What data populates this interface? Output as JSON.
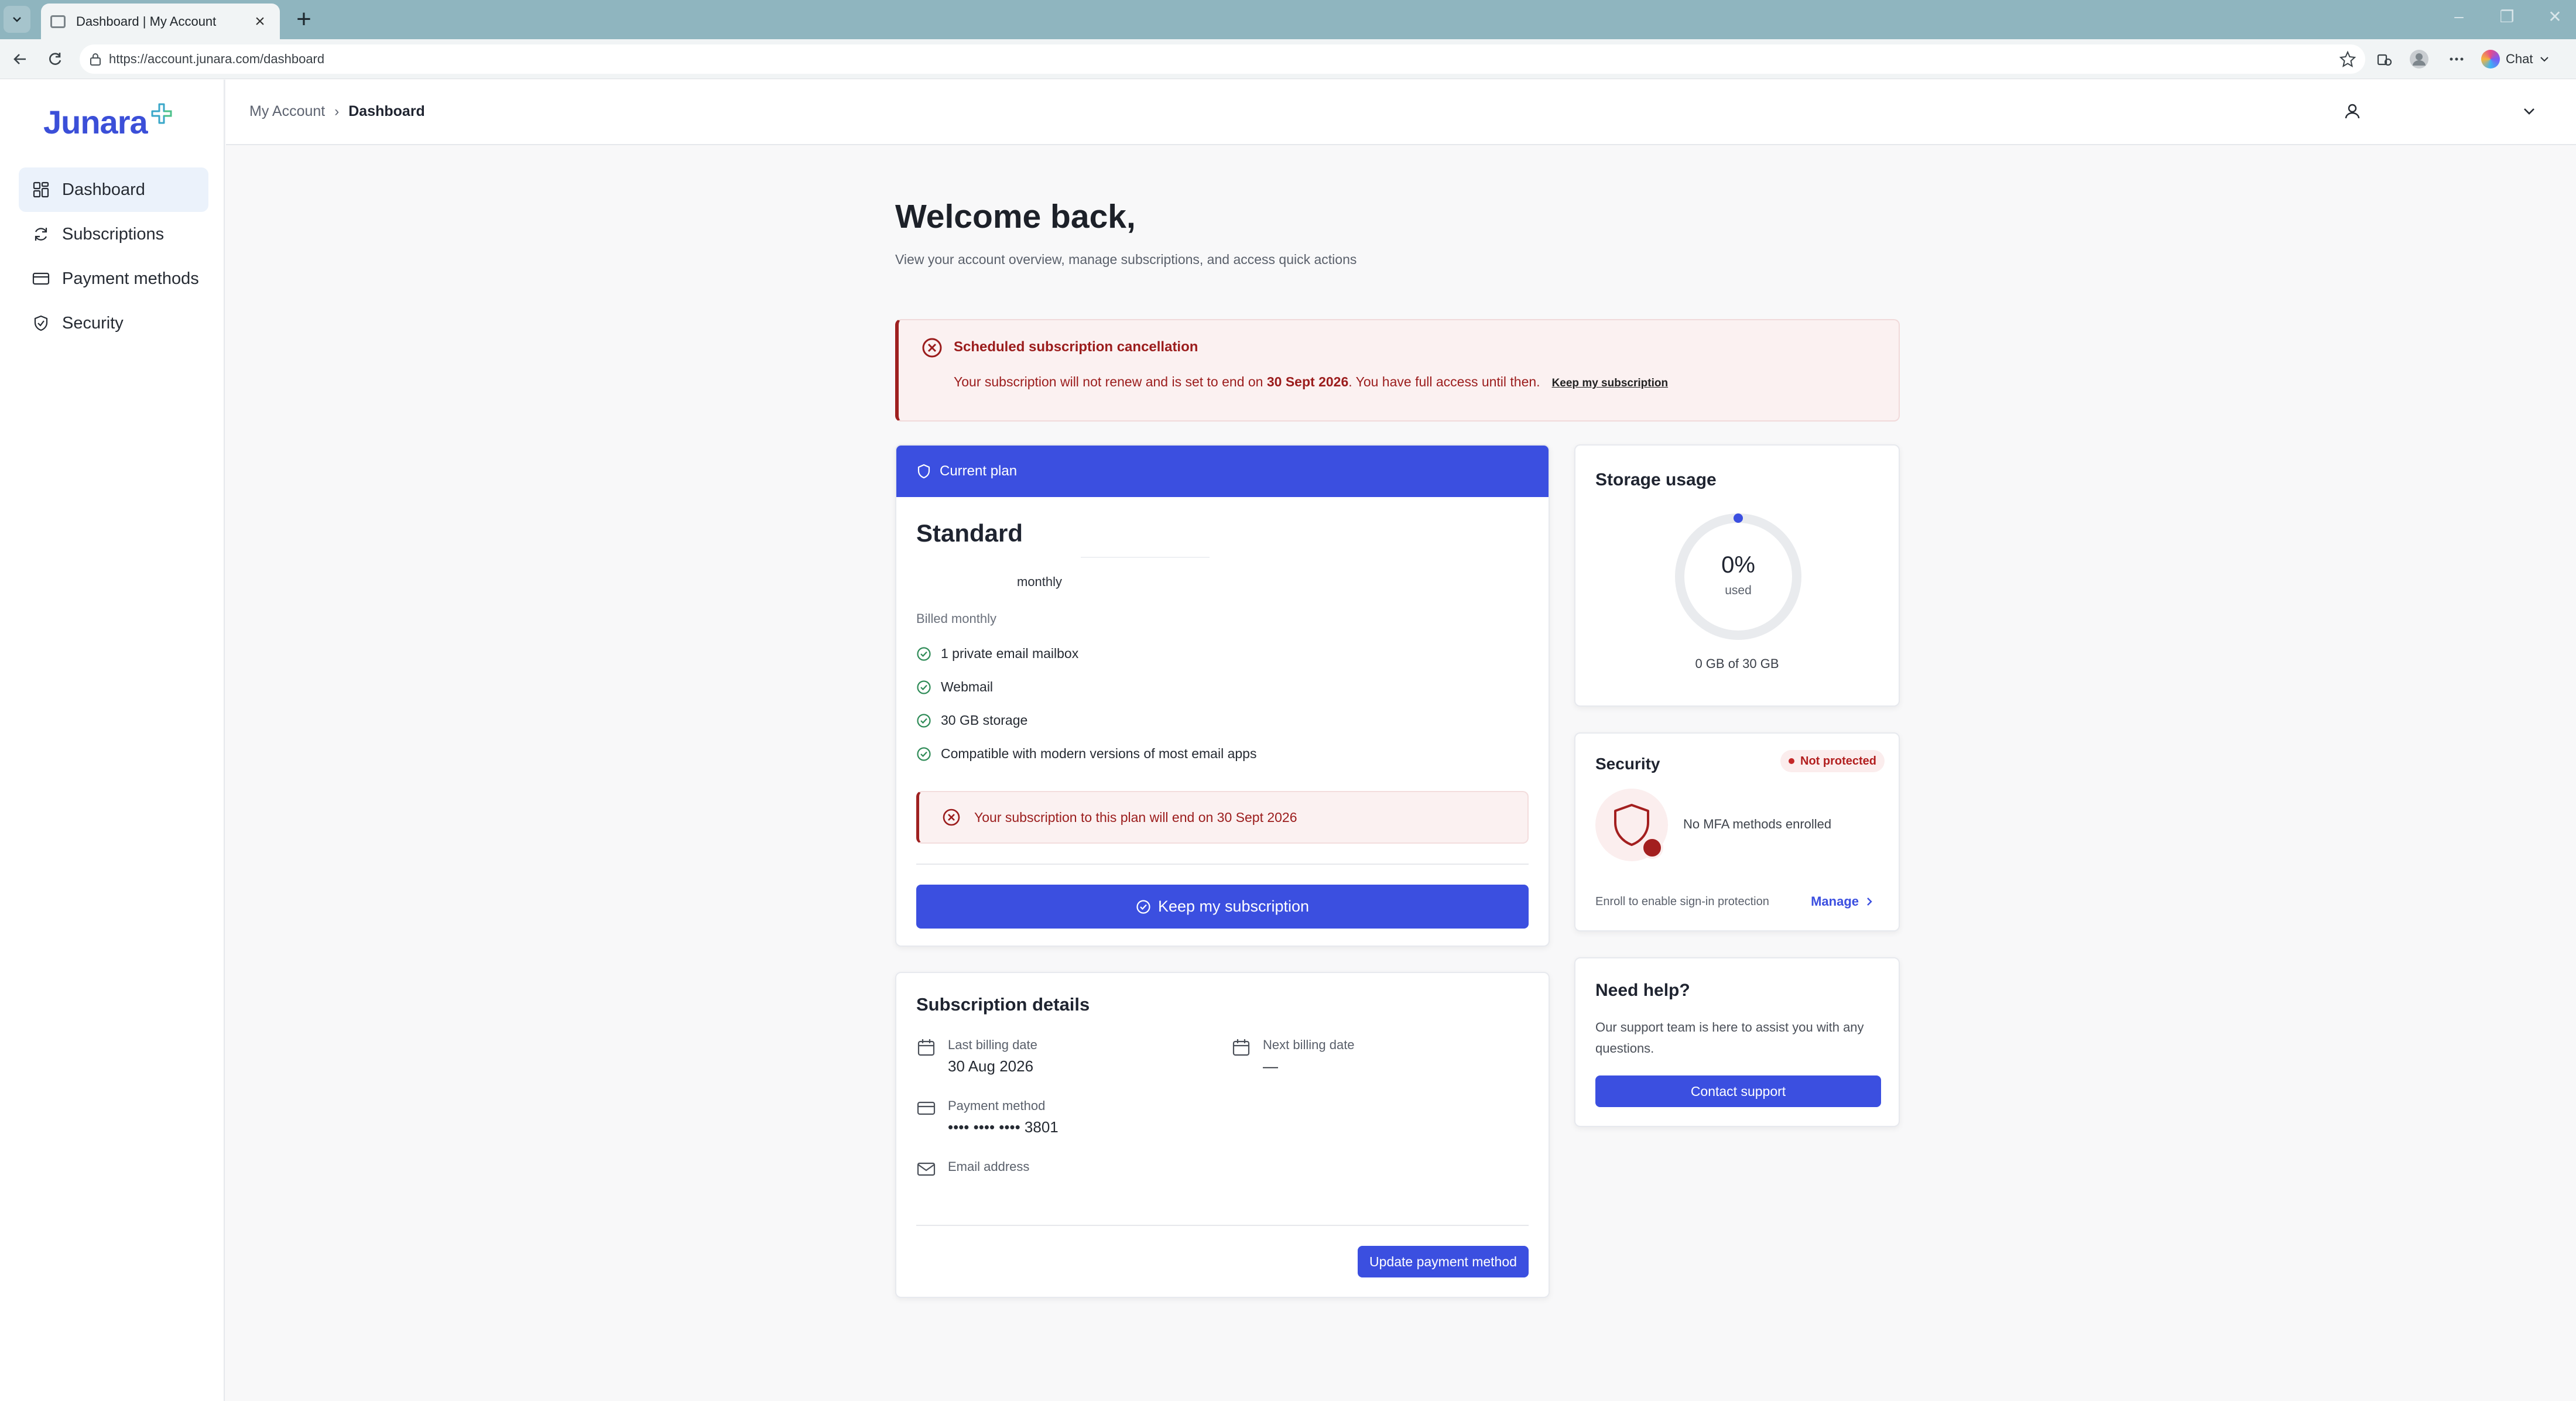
{
  "browser": {
    "tab_title": "Dashboard | My Account",
    "url": "https://account.junara.com/dashboard",
    "chat_label": "Chat"
  },
  "sidebar": {
    "logo_text": "Junara",
    "items": [
      {
        "label": "Dashboard",
        "icon": "dashboard-grid-icon",
        "active": true
      },
      {
        "label": "Subscriptions",
        "icon": "refresh-icon",
        "active": false
      },
      {
        "label": "Payment methods",
        "icon": "credit-card-icon",
        "active": false
      },
      {
        "label": "Security",
        "icon": "shield-check-icon",
        "active": false
      }
    ]
  },
  "topbar": {
    "breadcrumb_root": "My Account",
    "breadcrumb_current": "Dashboard"
  },
  "main": {
    "welcome": "Welcome back,",
    "subtitle": "View your account overview, manage subscriptions, and access quick actions"
  },
  "alert": {
    "title": "Scheduled subscription cancellation",
    "body_prefix": "Your subscription will not renew and is set to end on",
    "end_date": "30 Sept 2026",
    "body_suffix": ". You have full access until then.",
    "link": "Keep my subscription"
  },
  "plan": {
    "header": "Current plan",
    "name": "Standard",
    "period": "monthly",
    "billed": "Billed monthly",
    "features": [
      "1 private email mailbox",
      "Webmail",
      "30 GB storage",
      "Compatible with modern versions of most email apps"
    ],
    "warning": "Your subscription to this plan will end on 30 Sept 2026",
    "keep_button": "Keep my subscription"
  },
  "details": {
    "title": "Subscription details",
    "last_billing_label": "Last billing date",
    "last_billing_value": "30 Aug 2026",
    "next_billing_label": "Next billing date",
    "next_billing_value": "—",
    "payment_label": "Payment method",
    "payment_value": "•••• •••• •••• 3801",
    "email_label": "Email address",
    "email_value": "",
    "update_button": "Update payment method"
  },
  "storage": {
    "title": "Storage usage",
    "percent_text": "0%",
    "percent_value": 0,
    "used_label": "used",
    "summary": "0 GB of 30 GB"
  },
  "security": {
    "title": "Security",
    "badge": "Not protected",
    "message": "No MFA methods enrolled",
    "enroll_text": "Enroll to enable sign-in protection",
    "manage_link": "Manage"
  },
  "help": {
    "title": "Need help?",
    "body": "Our support team is here to assist you with any questions.",
    "button": "Contact support"
  },
  "colors": {
    "accent": "#3b4fe0",
    "danger": "#9b1c1c",
    "success": "#2e8b57"
  }
}
